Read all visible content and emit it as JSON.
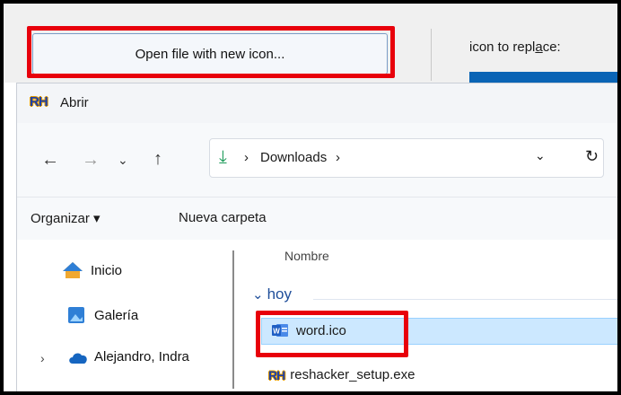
{
  "reshacker": {
    "open_button_label": "Open file with new icon...",
    "icon_to_replace_prefix": "icon to repl",
    "icon_to_replace_accel": "a",
    "icon_to_replace_suffix": "ce:"
  },
  "dialog": {
    "logo": "RH",
    "title": "Abrir",
    "breadcrumb": {
      "location": "Downloads",
      "separator": "›"
    },
    "toolbar": {
      "organize_label": "Organizar ▾",
      "new_folder_label": "Nueva carpeta"
    },
    "sidebar": {
      "items": [
        {
          "label": "Inicio",
          "icon": "home-icon"
        },
        {
          "label": "Galería",
          "icon": "gallery-icon"
        },
        {
          "label": "Alejandro, Indra",
          "icon": "cloud-icon"
        }
      ]
    },
    "file_list": {
      "column_name": "Nombre",
      "group_label": "hoy",
      "files": [
        {
          "name": "word.ico",
          "selected": true,
          "icon": "word-icon"
        },
        {
          "name": "reshacker_setup.exe",
          "selected": false,
          "icon": "reshacker-icon"
        }
      ]
    }
  },
  "colors": {
    "highlight_red": "#e8000b",
    "selection_blue": "#cce8ff",
    "accent_blue": "#0a64b5"
  }
}
